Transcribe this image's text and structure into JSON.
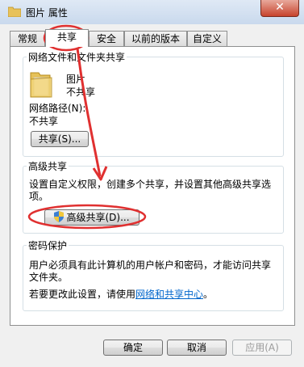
{
  "window": {
    "title": "图片 属性",
    "close_symbol": "✕"
  },
  "tabs": [
    {
      "label": "常规"
    },
    {
      "label": "共享"
    },
    {
      "label": "安全"
    },
    {
      "label": "以前的版本"
    },
    {
      "label": "自定义"
    }
  ],
  "network_share": {
    "legend": "网络文件和文件夹共享",
    "folder_name": "图片",
    "folder_status": "不共享",
    "path_label": "网络路径(N):",
    "path_value": "不共享",
    "share_button": "共享(S)..."
  },
  "advanced_share": {
    "legend": "高级共享",
    "description": "设置自定义权限，创建多个共享，并设置其他高级共享选项。",
    "desc_line1": "设置自定义权限，创建多个共享，并设置其他高级共享选",
    "desc_line2": "项。",
    "button": "高级共享(D)..."
  },
  "password": {
    "legend": "密码保护",
    "line1": "用户必须具有此计算机的用户帐户和密码，才能访问共享",
    "line2": "文件夹。",
    "change_prefix": "若要更改此设置，请使用",
    "link": "网络和共享中心",
    "suffix": "。"
  },
  "buttons": {
    "ok": "确定",
    "cancel": "取消",
    "apply": "应用(A)"
  },
  "colors": {
    "annotation": "#e03030",
    "link": "#0066cc",
    "title_gradient": "#c9d9ed"
  }
}
